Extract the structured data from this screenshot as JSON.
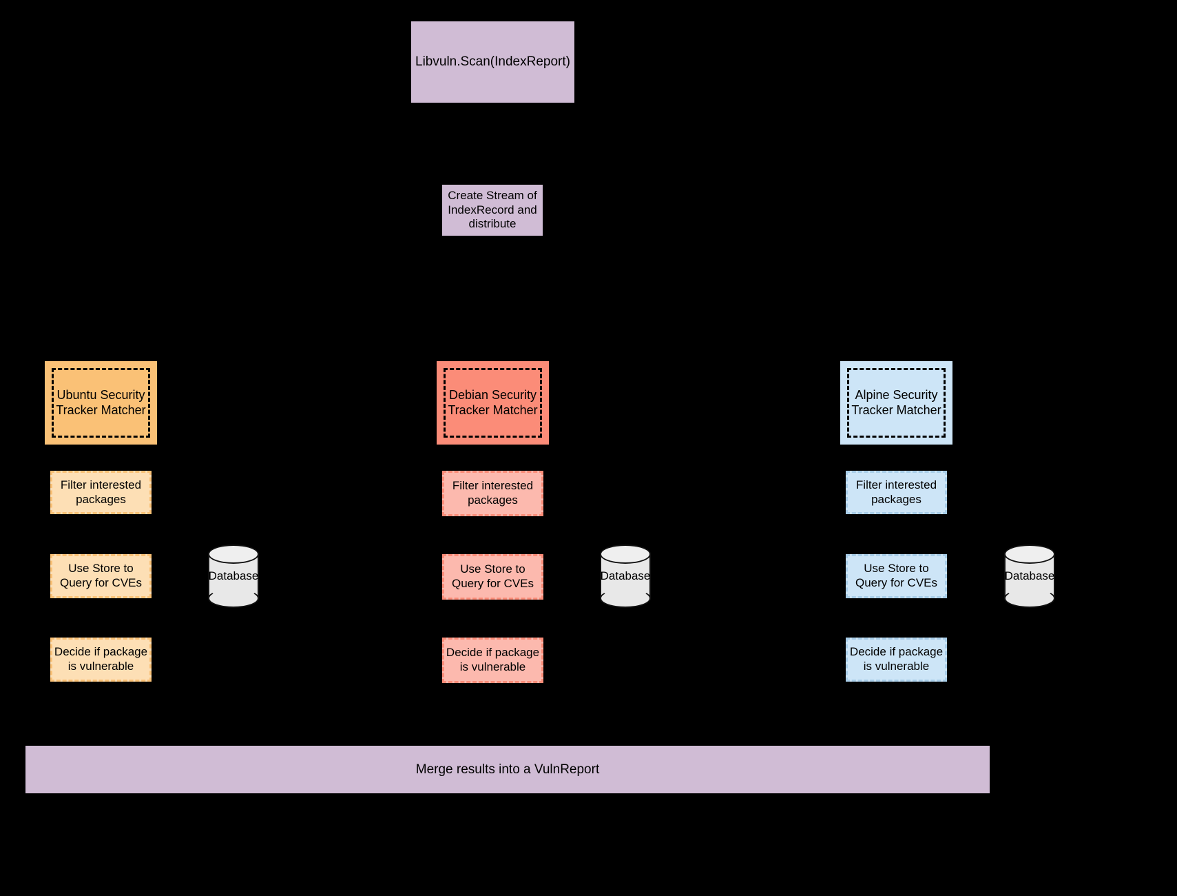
{
  "diagram": {
    "title_node": "Libvuln.Scan(IndexReport)",
    "stream_node": "Create Stream of\nIndexRecord and\ndistribute",
    "merge_node": "Merge results into a VulnReport",
    "database_label": "Database",
    "colors": {
      "background": "#000000",
      "purple": "#D0BCD5",
      "ubuntu_strong": "#FAC176",
      "ubuntu_light": "#FDDFB5",
      "debian_strong": "#FB8C78",
      "debian_light": "#FCB9AE",
      "alpine_strong": "#CDE5F7",
      "alpine_light": "#CDE5F7"
    },
    "columns": [
      {
        "key": "ubuntu",
        "matcher": "Ubuntu Security\nTracker Matcher",
        "steps": [
          "Filter interested\npackages",
          "Use Store to\nQuery for CVEs",
          "Decide if package\nis vulnerable"
        ],
        "database": "Database"
      },
      {
        "key": "debian",
        "matcher": "Debian Security\nTracker Matcher",
        "steps": [
          "Filter interested\npackages",
          "Use Store to\nQuery for CVEs",
          "Decide if package\nis vulnerable"
        ],
        "database": "Database"
      },
      {
        "key": "alpine",
        "matcher": "Alpine Security\nTracker Matcher",
        "steps": [
          "Filter interested\npackages",
          "Use Store to\nQuery for CVEs",
          "Decide if package\nis vulnerable"
        ],
        "database": "Database"
      }
    ]
  }
}
